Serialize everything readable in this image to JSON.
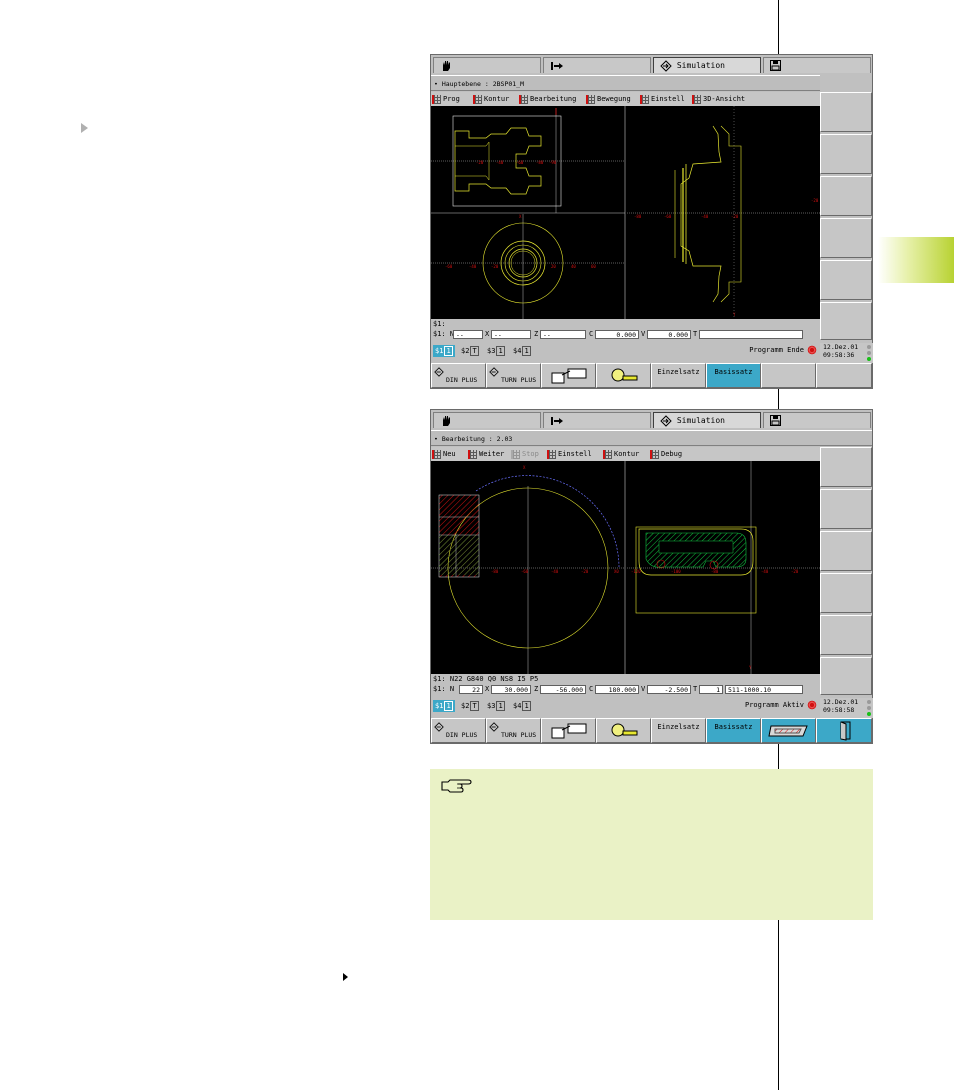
{
  "screen1": {
    "tabs": [
      {
        "icon": "hand-icon",
        "label": ""
      },
      {
        "icon": "program-arrow-icon",
        "label": ""
      },
      {
        "icon": "simulation-icon",
        "label": "Simulation"
      },
      {
        "icon": "floppy-disk-icon",
        "label": ""
      }
    ],
    "mode_line": "• Hauptebene :   2BSP01_M",
    "menu": [
      "Prog",
      "Kontur",
      "Bearbeitung",
      "Bewegung",
      "Einstell",
      "3D-Ansicht"
    ],
    "block_line": "$1:",
    "pos": {
      "prefix": "$1: N",
      "n": "--",
      "x_label": "X",
      "x": "--",
      "z_label": "Z",
      "z": "--",
      "c_label": "C",
      "c": "0.000",
      "v_label": "V",
      "v": "0.000",
      "t_label": "T",
      "t": ""
    },
    "channels": [
      "$1",
      "$2",
      "$3",
      "$4"
    ],
    "status": "Programm Ende",
    "date": "12.Dez.01",
    "time": "09:58:36",
    "softkeys": [
      {
        "label": "DIN PLUS"
      },
      {
        "label": "TURN PLUS"
      },
      {
        "label": ""
      },
      {
        "label": ""
      },
      {
        "label": "Einzelsatz"
      },
      {
        "label": "Basissatz"
      },
      {
        "label": ""
      },
      {
        "label": ""
      }
    ]
  },
  "screen2": {
    "tabs": [
      {
        "icon": "hand-icon",
        "label": ""
      },
      {
        "icon": "program-arrow-icon",
        "label": ""
      },
      {
        "icon": "simulation-icon",
        "label": "Simulation"
      },
      {
        "icon": "floppy-disk-icon",
        "label": ""
      }
    ],
    "mode_line": "• Bearbeitung :   2.03",
    "menu": [
      "Neu",
      "Weiter",
      "Stop",
      "Einstell",
      "Kontur",
      "Debug"
    ],
    "block_line": "$1: N22 G840 Q0 NS8 I5 P5",
    "pos": {
      "prefix": "$1: N",
      "n": "22",
      "x_label": "X",
      "x": "30.000",
      "z_label": "Z",
      "z": "-56.000",
      "c_label": "C",
      "c": "180.000",
      "v_label": "V",
      "v": "-2.500",
      "t_label": "T",
      "t": "1",
      "t_extra": "511-1000.10"
    },
    "channels": [
      "$1",
      "$2",
      "$3",
      "$4"
    ],
    "status": "Programm Aktiv",
    "date": "12.Dez.01",
    "time": "09:58:58",
    "softkeys": [
      {
        "label": "DIN PLUS"
      },
      {
        "label": "TURN PLUS"
      },
      {
        "label": ""
      },
      {
        "label": ""
      },
      {
        "label": "Einzelsatz"
      },
      {
        "label": "Basissatz"
      },
      {
        "label": ""
      },
      {
        "label": ""
      }
    ]
  },
  "note": {
    "icon": "pointing-hand-icon"
  },
  "colors": {
    "canvas_bg": "#000000",
    "contour": "#e8e830",
    "axis": "#d0d0d0",
    "tick_red": "#d01010",
    "hatch_green": "#10c040",
    "highlight_blue": "#3ca8c8",
    "note_bg": "#eaf2c6",
    "thumb_tab": "#b8d232"
  }
}
